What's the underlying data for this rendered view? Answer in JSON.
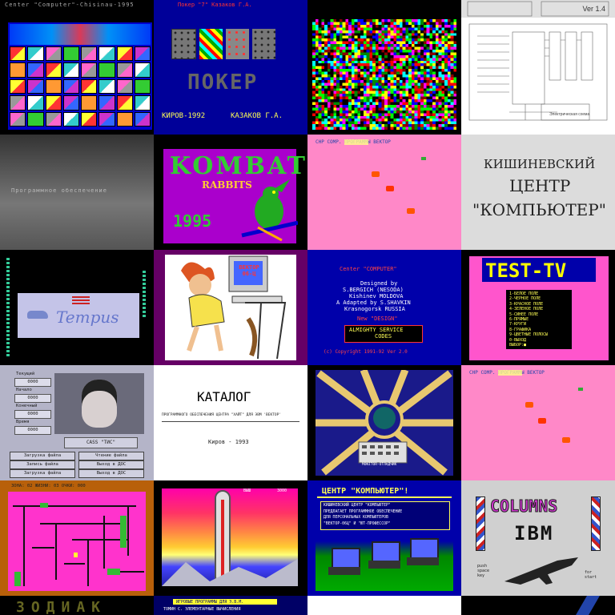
{
  "colors": {
    "dos_blue": "#0000aa",
    "magenta": "#ff00ff",
    "pink": "#ff88c8",
    "green": "#00aa00",
    "yellow": "#ffff00",
    "cyan": "#00ffff"
  },
  "tiles": {
    "r1c1": {
      "header": "Center \"Computer\"-Chisinau-1995"
    },
    "r1c2": {
      "header": "Покер \"7\"  Казаков Г.А.",
      "title": "ПОКЕР",
      "footer_left": "КИРОВ-1992",
      "footer_right": "КАЗАКОВ Г.А."
    },
    "r1c3": {},
    "r1c4": {
      "version": "Ver 1.4",
      "caption": "Электрическая схема"
    },
    "r2c1": {
      "text": "Программное обеспечение"
    },
    "r2c2": {
      "title": "KOMBAT",
      "subtitle": "RABBITS",
      "year": "1995"
    },
    "r2c3": {
      "header": "CHP COMP.   ПРОГРАММЫ ВЕКТОР"
    },
    "r2c4": {
      "line1": "КИШИНЕВСКИЙ",
      "line2": "ЦЕНТР",
      "line3": "\"КОМПЬЮТЕР\""
    },
    "r3c1": {
      "logo": "Tempus"
    },
    "r3c2": {
      "monitor": "ВЕКТОР 06-Ц"
    },
    "r3c3": {
      "header": "Center  \"COMPUTER\"",
      "line1": "Designed by",
      "line2": "S.BERGICH (NESODA)",
      "line3": "Kishinev MOLDOVA",
      "line4": "A Adapted by S.SHAVKIN",
      "line5": "Krasnogorsk RUSSIA",
      "line6": "New \"DESIGN\"",
      "box1": "ALMIGHTY SERVICE",
      "box2": "CODES",
      "footer": "(c) Copyright 1991-92 Ver 2.0"
    },
    "r3c4": {
      "title": "TEST-TV",
      "menu": [
        "1-БЕЛОЕ ПОЛЕ",
        "2-ЧЕРНОЕ ПОЛЕ",
        "3-КРАСНОЕ ПОЛЕ",
        "4-ЗЕЛЕНОЕ ПОЛЕ",
        "5-СИНЕЕ ПОЛЕ",
        "6-ПРЯМЫЕ",
        "7-КРУГИ",
        "8-ГРАФИКА",
        "9-ЦВЕТНЫЕ ПОЛОСЫ",
        "0-ВЫХОД",
        "ВЫБОР:■"
      ]
    },
    "r4c1": {
      "labels": [
        "Текущий",
        "Начало",
        "Конечный",
        "Время"
      ],
      "values": [
        "0000",
        "0000",
        "0000",
        "0000"
      ],
      "name_box": "CASS \"ТИС\"",
      "buttons": [
        "Загрузка файла",
        "Чтение файла",
        "Запись файла",
        "Выход в ДОС",
        "Загрузка файла",
        "Выход в ДОС"
      ]
    },
    "r4c2": {
      "title": "КАТАЛОГ",
      "subtitle": "ПРОГРАММНОГО ОБЕСПЕЧЕНИЯ ЦЕНТРА \"ХАЙТ\" ДЛЯ ЭВМ 'ВЕКТОР'",
      "footer": "Киров - 1993"
    },
    "r4c3": {
      "caption": "MONITOR-ОТЛАДЧИК"
    },
    "r4c4": {
      "header": "CHP COMP.   ПРОГРАММЫ ВЕКТОР"
    },
    "r5c1": {
      "header": "ЗОНА: 02  ЖИЗНИ: 03  ОЧКИ: 000"
    },
    "r5c2": {
      "hud_left": "ВЫШ",
      "hud_right": "3000"
    },
    "r5c3": {
      "title": "ЦЕНТР \"КОМПЬЮТЕР\"!",
      "text": [
        "КИШИНЕВСКИЙ ЦЕНТР \"КОМПЬЮТЕР\"",
        "ПРЕДЛАГАЕТ ПРОГРАММНОЕ ОБЕСПЕЧЕНИЕ",
        "ДЛЯ ПЕРСОНАЛЬНЫХ КОМПЬЮТЕРОВ",
        "\"ВЕКТОР-06Ц\" И \"ЮТ-ПРОФЕССОР\""
      ]
    },
    "r5c4": {
      "logo1": "COLUMNS",
      "logo2": "IBM",
      "hint_left": "push\nspace\nkey",
      "hint_right": "for\nstart"
    },
    "r6c1": {
      "text": "ЗОДИАК"
    },
    "r6c2": {
      "line1": "ИГРОВЫЕ ПРОГРАММЫ ДЛЯ Э.В.М.",
      "line2": "ТОМИН С. ЭЛЕМЕНТАРНЫЕ ВЫЧИСЛЕНИЯ"
    }
  }
}
